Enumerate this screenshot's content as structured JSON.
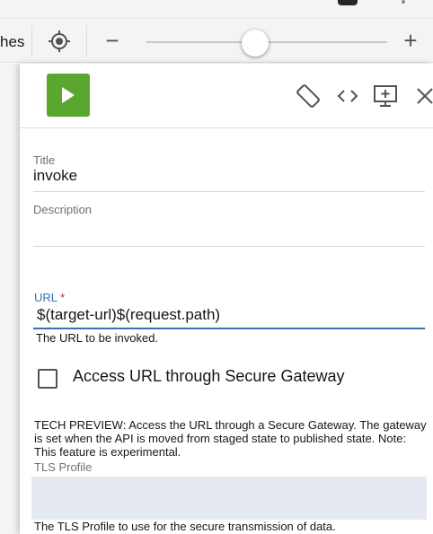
{
  "toolbar": {
    "breadcrumb_partial": "hes",
    "zoom_out": "−",
    "zoom_in": "+",
    "zoom_level": 0.45
  },
  "panel": {
    "actions": [
      "play-icon",
      "rotate-icon",
      "code-icon",
      "present-icon",
      "close-icon"
    ],
    "title_label": "Title",
    "title_value": "invoke",
    "description_label": "Description",
    "description_value": "",
    "url_label": "URL",
    "url_required_mark": "*",
    "url_value": "$(target-url)$(request.path)",
    "url_helper": "The URL to be invoked.",
    "secure_gateway_label": "Access URL through Secure Gateway",
    "secure_gateway_checked": false,
    "tech_preview_text": "TECH PREVIEW: Access the URL through a Secure Gateway. The gateway is set when the API is moved from staged state to published state. Note: This feature is experimental.",
    "tls_label": "TLS Profile",
    "tls_value": "",
    "tls_helper": "The TLS Profile to use for the secure transmission of data."
  },
  "colors": {
    "play_button": "#5aa62e",
    "url_label": "#3d70b2",
    "required": "#da1e28",
    "tls_input_bg": "#e5eaf2"
  }
}
